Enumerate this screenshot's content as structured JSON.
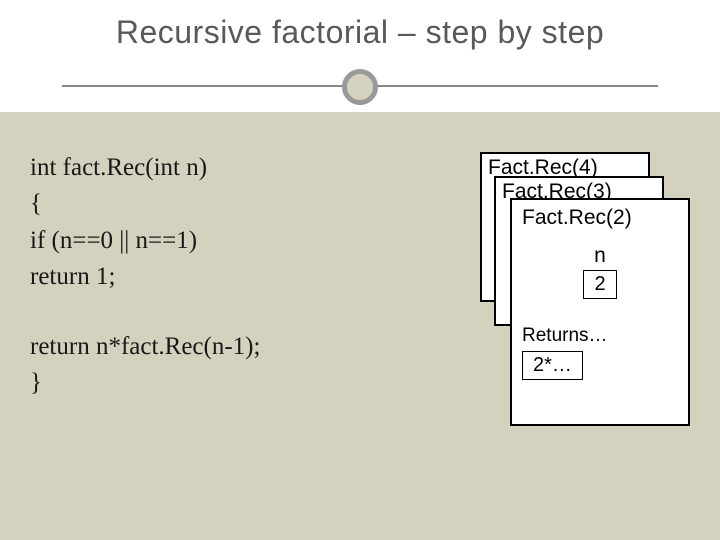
{
  "title": "Recursive factorial – step by step",
  "code": {
    "l1a": "int",
    "l1b": " fact.Rec(",
    "l1c": "int",
    "l1d": " n)",
    "l2": "{",
    "l3": "   if (n==0 || n==1)",
    "l4": "      return 1;",
    "l5": "      return n*fact.Rec(n-1);",
    "l6": "}"
  },
  "stack": {
    "frames": [
      {
        "label": "Fact.Rec(4)"
      },
      {
        "label": "Fact.Rec(3)"
      },
      {
        "label": "Fact.Rec(2)",
        "var_name": "n",
        "var_value": "2",
        "returns_label": "Returns…",
        "returns_value": "2*…"
      }
    ]
  }
}
